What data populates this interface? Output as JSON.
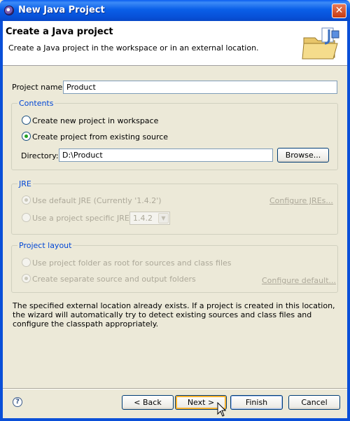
{
  "window": {
    "title": "New Java Project",
    "close_glyph": "✕"
  },
  "header": {
    "title": "Create a Java project",
    "description": "Create a Java project in the workspace or in an external location.",
    "graphic_icon": "new-folder-wizard-icon"
  },
  "project_name": {
    "label": "Project name:",
    "value": "Product"
  },
  "contents": {
    "title": "Contents",
    "option_new": "Create new project in workspace",
    "option_existing": "Create project from existing source",
    "directory_label": "Directory:",
    "directory_value": "D:\\Product",
    "browse_label": "Browse..."
  },
  "jre": {
    "title": "JRE",
    "option_default": "Use default JRE (Currently '1.4.2')",
    "configure_link": "Configure JREs...",
    "option_specific": "Use a project specific JRE:",
    "specific_value": "1.4.2"
  },
  "layout": {
    "title": "Project layout",
    "option_root": "Use project folder as root for sources and class files",
    "option_separate": "Create separate source and output folders",
    "configure_link": "Configure default..."
  },
  "message": "The specified external location already exists. If a project is created in this location, the wizard will automatically try to detect existing sources and class files and configure the classpath appropriately.",
  "footer": {
    "help_glyph": "?",
    "back_label": "< Back",
    "next_label": "Next >",
    "finish_label": "Finish",
    "cancel_label": "Cancel"
  },
  "colors": {
    "titlebar": "#0a5fe8",
    "group_title": "#0046d5",
    "disabled": "#aca899",
    "radio_check": "#21a121"
  }
}
